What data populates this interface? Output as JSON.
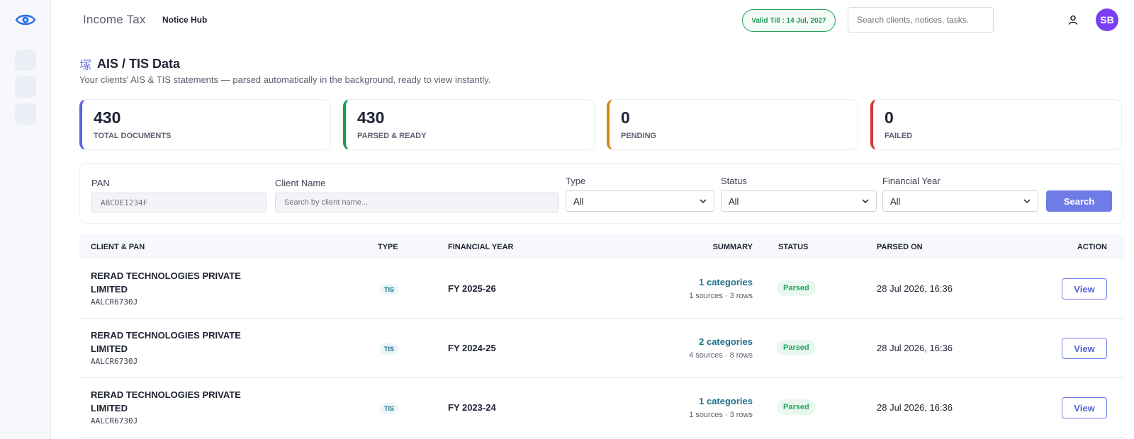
{
  "header": {
    "brand": "Income Tax",
    "nav_label": "Notice Hub",
    "validity": "Valid Till : 14 Jul, 2027",
    "search_placeholder": "Search clients, notices, tasks.",
    "avatar_initials": "SB"
  },
  "page": {
    "title_icon": "塚",
    "title": "AIS / TIS Data",
    "subtitle": "Your clients' AIS & TIS statements — parsed automatically in the background, ready to view instantly."
  },
  "stats": [
    {
      "value": "430",
      "label": "TOTAL DOCUMENTS",
      "color": "#5b63e6"
    },
    {
      "value": "430",
      "label": "PARSED & READY",
      "color": "#1e9d4f"
    },
    {
      "value": "0",
      "label": "PENDING",
      "color": "#d98612"
    },
    {
      "value": "0",
      "label": "FAILED",
      "color": "#d33535"
    }
  ],
  "filters": {
    "pan_label": "PAN",
    "pan_placeholder": "ABCDE1234F",
    "client_label": "Client Name",
    "client_placeholder": "Search by client name...",
    "type_label": "Type",
    "type_value": "All",
    "status_label": "Status",
    "status_value": "All",
    "fy_label": "Financial Year",
    "fy_value": "All",
    "search_button": "Search"
  },
  "table": {
    "headers": {
      "client": "CLIENT & PAN",
      "type": "TYPE",
      "fy": "FINANCIAL YEAR",
      "summary": "SUMMARY",
      "status": "STATUS",
      "parsed_on": "PARSED ON",
      "action": "ACTION"
    },
    "rows": [
      {
        "client": "RERAD TECHNOLOGIES PRIVATE LIMITED",
        "pan": "AALCR6730J",
        "type": "TIS",
        "fy": "FY 2025-26",
        "categories": "1 categories",
        "meta": "1 sources · 3 rows",
        "status": "Parsed",
        "parsed_on": "28 Jul 2026, 16:36",
        "action": "View"
      },
      {
        "client": "RERAD TECHNOLOGIES PRIVATE LIMITED",
        "pan": "AALCR6730J",
        "type": "TIS",
        "fy": "FY 2024-25",
        "categories": "2 categories",
        "meta": "4 sources · 8 rows",
        "status": "Parsed",
        "parsed_on": "28 Jul 2026, 16:36",
        "action": "View"
      },
      {
        "client": "RERAD TECHNOLOGIES PRIVATE LIMITED",
        "pan": "AALCR6730J",
        "type": "TIS",
        "fy": "FY 2023-24",
        "categories": "1 categories",
        "meta": "1 sources · 3 rows",
        "status": "Parsed",
        "parsed_on": "28 Jul 2026, 16:36",
        "action": "View"
      }
    ]
  },
  "colors": {
    "accent": "#6f7ce8",
    "success": "#22a45d",
    "link": "#1f6f8b",
    "avatar": "#7b3ff2"
  }
}
